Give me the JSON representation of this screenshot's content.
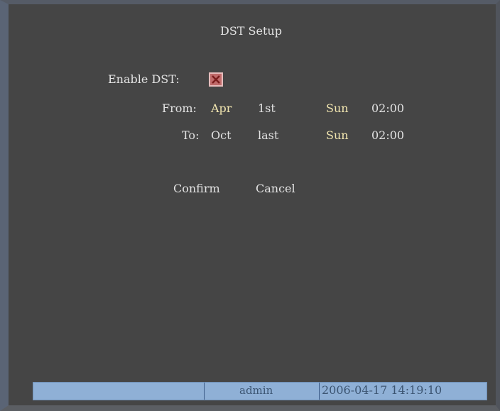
{
  "title": "DST Setup",
  "enable_dst": {
    "label": "Enable DST:",
    "checked": true
  },
  "from": {
    "label": "From:",
    "month": "Apr",
    "week": "1st",
    "day": "Sun",
    "time": "02:00"
  },
  "to": {
    "label": "To:",
    "month": "Oct",
    "week": "last",
    "day": "Sun",
    "time": "02:00"
  },
  "buttons": {
    "confirm": "Confirm",
    "cancel": "Cancel"
  },
  "status_bar": {
    "user": "admin",
    "datetime": "2006-04-17 14:19:10"
  },
  "icons": {
    "checkbox": "checkbox-checked-icon"
  },
  "colors": {
    "background": "#454545",
    "status_bar": "#8fb0d6",
    "checkbox_fill": "#c06a6a"
  }
}
